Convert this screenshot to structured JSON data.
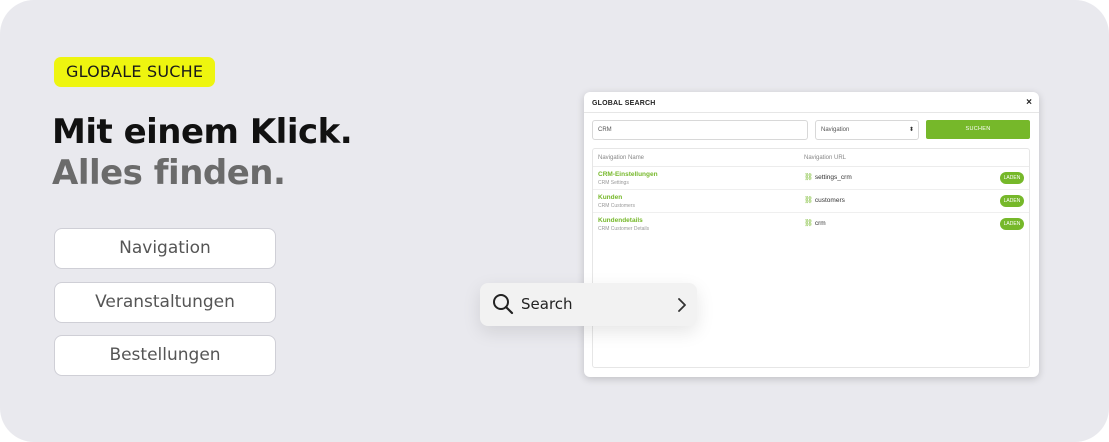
{
  "hero": {
    "badge": "GLOBALE SUCHE",
    "headline_line1": "Mit einem Klick.",
    "headline_line2": "Alles finden."
  },
  "options": [
    "Navigation",
    "Veranstaltungen",
    "Bestellungen"
  ],
  "modal": {
    "title": "GLOBAL SEARCH",
    "close_icon": "×",
    "search_value": "CRM",
    "select_value": "Navigation",
    "select_arrows": "⬍",
    "search_button": "SUCHEN",
    "columns": [
      "Navigation Name",
      "Navigation URL"
    ],
    "rows": [
      {
        "name": "CRM-Einstellungen",
        "sub": "CRM Settings",
        "url": "settings_crm",
        "action": "LADEN"
      },
      {
        "name": "Kunden",
        "sub": "CRM Customers",
        "url": "customers",
        "action": "LADEN"
      },
      {
        "name": "Kundendetails",
        "sub": "CRM Customer Details",
        "url": "crm",
        "action": "LADEN"
      }
    ],
    "link_icon": "link-icon"
  },
  "searchbar": {
    "text": "Search",
    "icon": "search-icon",
    "chevron": "chevron-right-icon"
  },
  "colors": {
    "background": "#e9e9ee",
    "badge": "#eef50f",
    "accent_green": "#76b82a",
    "heading_dark": "#111111",
    "heading_gray": "#6b6b6b"
  }
}
